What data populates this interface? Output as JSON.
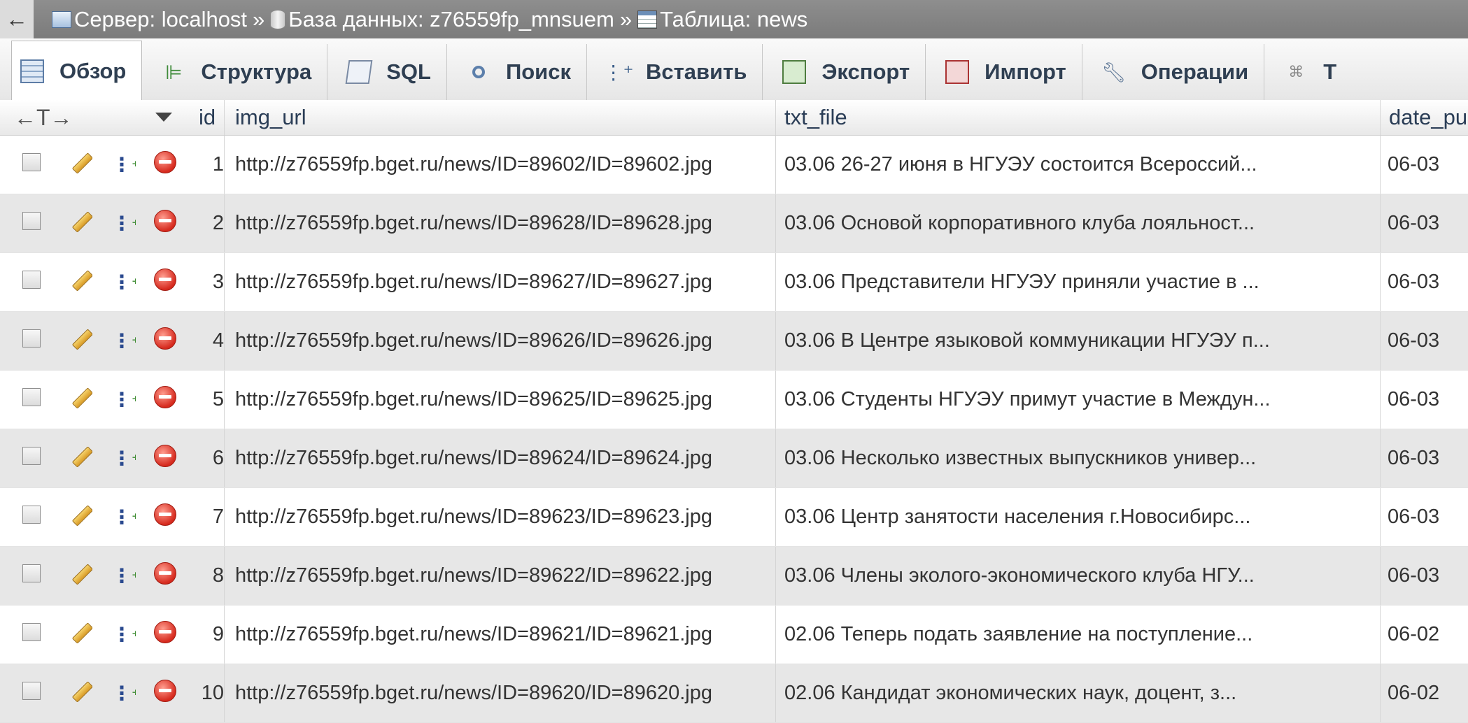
{
  "breadcrumb": {
    "back": "←",
    "server_label": "Сервер: localhost",
    "database_label": "База данных: z76559fp_mnsuem",
    "table_label": "Таблица: news",
    "separator": "»"
  },
  "tabs": [
    {
      "label": "Обзор",
      "icon": "browse-icon",
      "active": true
    },
    {
      "label": "Структура",
      "icon": "structure-icon"
    },
    {
      "label": "SQL",
      "icon": "sql-icon"
    },
    {
      "label": "Поиск",
      "icon": "search-icon"
    },
    {
      "label": "Вставить",
      "icon": "insert-icon"
    },
    {
      "label": "Экспорт",
      "icon": "export-icon"
    },
    {
      "label": "Импорт",
      "icon": "import-icon"
    },
    {
      "label": "Операции",
      "icon": "operations-icon"
    },
    {
      "label": "Т",
      "icon": "triggers-icon"
    }
  ],
  "table": {
    "header_arrows": "←T→",
    "columns": [
      "id",
      "img_url",
      "txt_file",
      "date_pu"
    ],
    "rows": [
      {
        "id": "1",
        "img_url": "http://z76559fp.bget.ru/news/ID=89602/ID=89602.jpg",
        "txt_file": "03.06 26-27 июня в НГУЭУ состоится Всероссий...",
        "date": "06-03"
      },
      {
        "id": "2",
        "img_url": "http://z76559fp.bget.ru/news/ID=89628/ID=89628.jpg",
        "txt_file": "03.06 Основой корпоративного клуба лояльност...",
        "date": "06-03"
      },
      {
        "id": "3",
        "img_url": "http://z76559fp.bget.ru/news/ID=89627/ID=89627.jpg",
        "txt_file": "03.06 Представители НГУЭУ приняли участие в ...",
        "date": "06-03"
      },
      {
        "id": "4",
        "img_url": "http://z76559fp.bget.ru/news/ID=89626/ID=89626.jpg",
        "txt_file": "03.06 В Центре языковой коммуникации НГУЭУ п...",
        "date": "06-03"
      },
      {
        "id": "5",
        "img_url": "http://z76559fp.bget.ru/news/ID=89625/ID=89625.jpg",
        "txt_file": "03.06 Студенты НГУЭУ примут участие в Междун...",
        "date": "06-03"
      },
      {
        "id": "6",
        "img_url": "http://z76559fp.bget.ru/news/ID=89624/ID=89624.jpg",
        "txt_file": "03.06 Несколько известных выпускников универ...",
        "date": "06-03"
      },
      {
        "id": "7",
        "img_url": "http://z76559fp.bget.ru/news/ID=89623/ID=89623.jpg",
        "txt_file": "03.06 Центр занятости населения г.Новосибирс...",
        "date": "06-03"
      },
      {
        "id": "8",
        "img_url": "http://z76559fp.bget.ru/news/ID=89622/ID=89622.jpg",
        "txt_file": "03.06 Члены эколого-экономического клуба НГУ...",
        "date": "06-03"
      },
      {
        "id": "9",
        "img_url": "http://z76559fp.bget.ru/news/ID=89621/ID=89621.jpg",
        "txt_file": "02.06 Теперь подать заявление на поступление...",
        "date": "06-02"
      },
      {
        "id": "10",
        "img_url": "http://z76559fp.bget.ru/news/ID=89620/ID=89620.jpg",
        "txt_file": "02.06 Кандидат экономических наук, доцент, з...",
        "date": "06-02"
      }
    ]
  }
}
